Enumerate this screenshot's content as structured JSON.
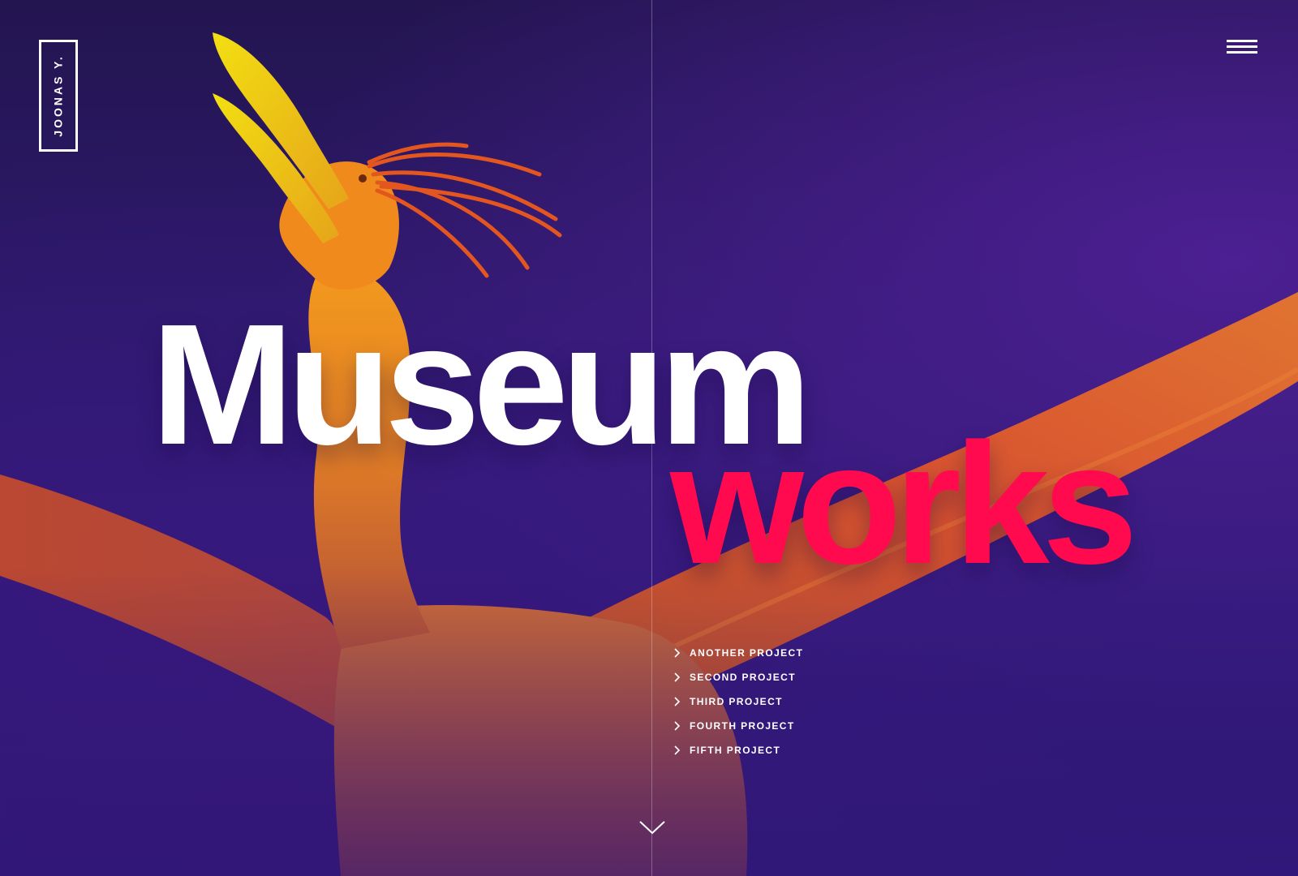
{
  "brand": {
    "logo_text": "JOONAS Y."
  },
  "header": {
    "menu_icon": "hamburger-menu-icon"
  },
  "hero": {
    "title_word_1": "Museum",
    "title_word_2": "works",
    "title_color_1": "#ffffff",
    "title_color_2": "#ff0a4e"
  },
  "projects": {
    "items": [
      {
        "label": "ANOTHER PROJECT",
        "icon": "chevron-right-icon"
      },
      {
        "label": "SECOND PROJECT",
        "icon": "chevron-right-icon"
      },
      {
        "label": "THIRD PROJECT",
        "icon": "chevron-right-icon"
      },
      {
        "label": "FOURTH PROJECT",
        "icon": "chevron-right-icon"
      },
      {
        "label": "FIFTH PROJECT",
        "icon": "chevron-right-icon"
      }
    ]
  },
  "footer": {
    "scroll_icon": "chevron-down-icon"
  },
  "colors": {
    "background": "#2c1768",
    "accent": "#ff0a4e",
    "bird": "#f07a1e"
  }
}
